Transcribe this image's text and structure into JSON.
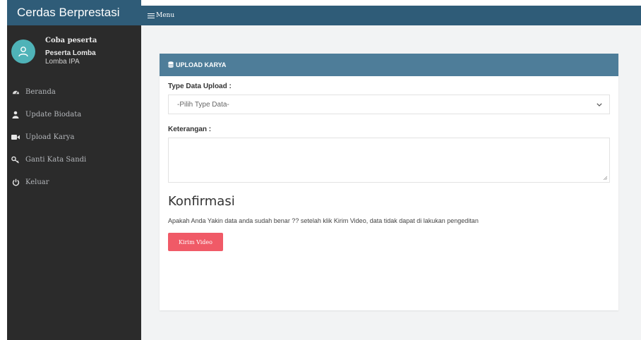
{
  "sidebar": {
    "brand": "Cerdas Berprestasi",
    "user": {
      "name": "Coba peserta",
      "role": "Peserta Lomba",
      "competition": "Lomba IPA"
    },
    "items": [
      {
        "label": "Beranda",
        "icon": "dashboard-icon"
      },
      {
        "label": "Update Biodata",
        "icon": "user-icon"
      },
      {
        "label": "Upload Karya",
        "icon": "video-camera-icon"
      },
      {
        "label": "Ganti Kata Sandi",
        "icon": "key-icon"
      },
      {
        "label": "Keluar",
        "icon": "power-icon"
      }
    ]
  },
  "topbar": {
    "menu_label": "Menu",
    "icon": "hamburger-icon"
  },
  "card": {
    "header": "UPLOAD KARYA",
    "header_icon": "database-icon",
    "type_label": "Type Data Upload :",
    "type_select_value": "-Pilih Type Data-",
    "notes_label": "Keterangan :",
    "confirm_title": "Konfirmasi",
    "confirm_text": "Apakah Anda Yakin data anda sudah benar ?? setelah klik Kirim Video, data tidak dapat di lakukan pengeditan",
    "submit_label": "Kirim Video"
  },
  "colors": {
    "topbar": "#2f5c78",
    "card_header": "#4e7d99",
    "sidebar": "#2b2b2b",
    "button": "#f05a67",
    "avatar": "#4fb3b8"
  }
}
